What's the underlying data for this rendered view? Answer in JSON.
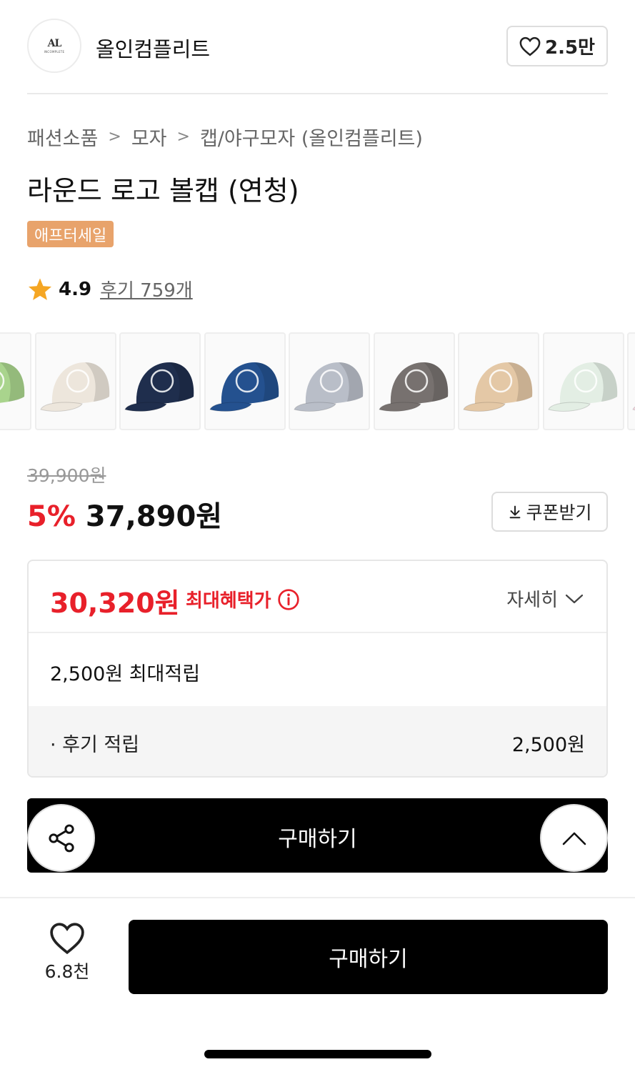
{
  "brand": {
    "name": "올인컴플리트",
    "logo_mark": "AL",
    "logo_text": "INCOMPLETE",
    "like_count": "2.5만"
  },
  "breadcrumb": [
    "패션소품",
    "모자",
    "캡/야구모자 (올인컴플리트)"
  ],
  "product": {
    "title": "라운드 로고 볼캡 (연청)",
    "badge": "애프터세일",
    "rating": "4.9",
    "reviews": "후기 759개"
  },
  "thumbnails": [
    {
      "name": "mint-green-cap",
      "color": "#a9d48d"
    },
    {
      "name": "ivory-cap",
      "color": "#ede6dc"
    },
    {
      "name": "navy-cap",
      "color": "#1f2e4d"
    },
    {
      "name": "blue-cap",
      "color": "#24518f"
    },
    {
      "name": "light-gray-cap",
      "color": "#b9bec8"
    },
    {
      "name": "charcoal-cap",
      "color": "#77716f"
    },
    {
      "name": "beige-cap",
      "color": "#e4c8a6"
    },
    {
      "name": "mint-white-cap",
      "color": "#e3eee4"
    }
  ],
  "pricing": {
    "original": "39,900원",
    "discount": "5%",
    "price": "37,890원",
    "coupon_label": "쿠폰받기"
  },
  "benefit": {
    "max_price": "30,320원",
    "max_label": "최대혜택가",
    "detail_label": "자세히",
    "points_max": "2,500원 최대적립",
    "points_row_label": "· 후기 적립",
    "points_row_value": "2,500원"
  },
  "buy_bar": {
    "label": "구매하기"
  },
  "bottom": {
    "like_count": "6.8천",
    "buy_label": "구매하기"
  },
  "colors": {
    "accent_red": "#e8202a",
    "badge_orange": "#e8a36b",
    "star": "#f5a623"
  }
}
